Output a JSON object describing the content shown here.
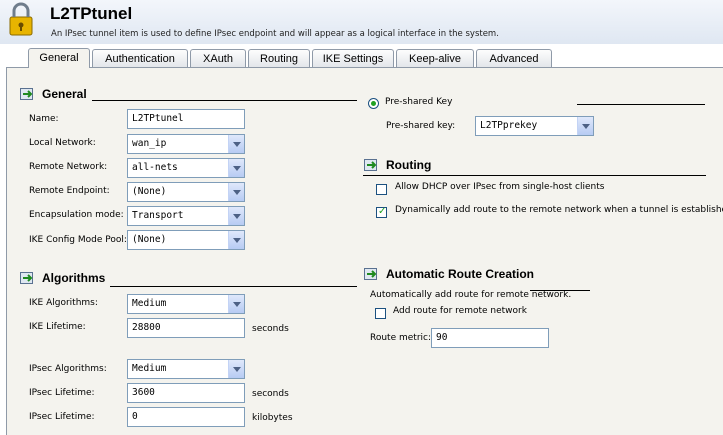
{
  "header": {
    "title": "L2TPtunel",
    "subtitle": "An IPsec tunnel item is used to define IPsec endpoint and will appear as a logical interface in the system."
  },
  "tabs": [
    "General",
    "Authentication",
    "XAuth",
    "Routing",
    "IKE Settings",
    "Keep-alive",
    "Advanced"
  ],
  "active_tab": "General",
  "general": {
    "title": "General",
    "name_label": "Name:",
    "name_value": "L2TPtunel",
    "local_network_label": "Local Network:",
    "local_network_value": "wan_ip",
    "remote_network_label": "Remote Network:",
    "remote_network_value": "all-nets",
    "remote_endpoint_label": "Remote Endpoint:",
    "remote_endpoint_value": "(None)",
    "encapsulation_label": "Encapsulation mode:",
    "encapsulation_value": "Transport",
    "ike_config_label": "IKE Config Mode Pool:",
    "ike_config_value": "(None)"
  },
  "algorithms": {
    "title": "Algorithms",
    "ike_alg_label": "IKE Algorithms:",
    "ike_alg_value": "Medium",
    "ike_lifetime_label": "IKE Lifetime:",
    "ike_lifetime_value": "28800",
    "ike_lifetime_unit": "seconds",
    "ipsec_alg_label": "IPsec Algorithms:",
    "ipsec_alg_value": "Medium",
    "ipsec_lifetime_label": "IPsec Lifetime:",
    "ipsec_lifetime_value": "3600",
    "ipsec_lifetime_unit": "seconds",
    "ipsec_lifetime_kb_label": "IPsec Lifetime:",
    "ipsec_lifetime_kb_value": "0",
    "ipsec_lifetime_kb_unit": "kilobytes"
  },
  "psk": {
    "radio_label": "Pre-shared Key",
    "key_label": "Pre-shared key:",
    "key_value": "L2TPprekey"
  },
  "routing": {
    "title": "Routing",
    "dhcp_label": "Allow DHCP over IPsec from single-host clients",
    "dynamic_route_label": "Dynamically add route to the remote network when a tunnel is established"
  },
  "auto_route": {
    "title": "Automatic Route Creation",
    "description": "Automatically add route for remote network.",
    "add_route_label": "Add route for remote network",
    "metric_label": "Route metric:",
    "metric_value": "90"
  },
  "colors": {
    "accent": "#21a121",
    "border": "#7f9db9",
    "panel": "#f4f3ee"
  }
}
